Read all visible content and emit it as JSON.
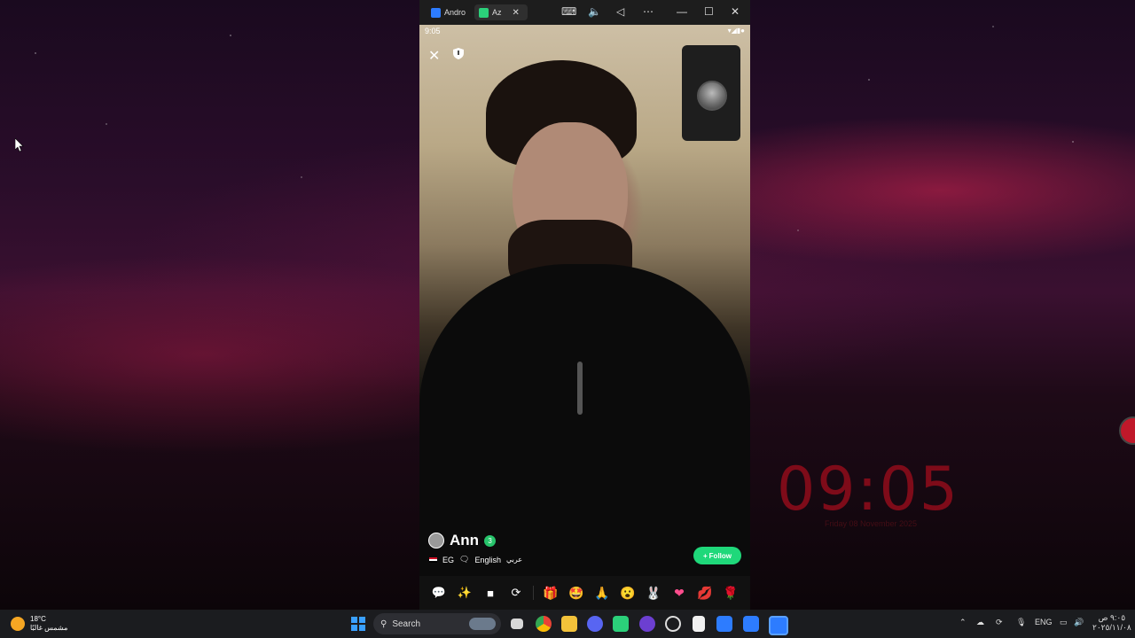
{
  "desktop": {
    "clock_time": "09:05",
    "clock_subtitle": "Friday 08 November 2025"
  },
  "window": {
    "tabs": [
      {
        "label": "Andro",
        "icon": "app-icon"
      },
      {
        "label": "Az",
        "icon": "chat-app-icon"
      }
    ],
    "toolbar_icons": [
      "keyboard-icon",
      "volume-icon",
      "back-icon",
      "more-icon",
      "minimize-icon",
      "maximize-icon",
      "close-icon"
    ]
  },
  "phone": {
    "status_time": "9:05",
    "status_icons": "▾◢▮●",
    "user": {
      "name": "Ann",
      "verified_badge": "3",
      "country": "EG",
      "languages": "English",
      "languages_extra": "عربي"
    },
    "follow_label": "Follow",
    "follow_prefix": "+",
    "controls": [
      "message-icon",
      "magic-wand-icon",
      "camera-icon",
      "switch-camera-icon"
    ],
    "gifts": [
      "gift-box-icon",
      "star-face-icon",
      "praying-hands-icon",
      "surprised-face-icon",
      "bunny-icon",
      "heart-icon",
      "lips-icon",
      "rose-icon"
    ]
  },
  "taskbar": {
    "weather_temp": "18°C",
    "weather_desc": "مشمس غالبًا",
    "search_label": "Search",
    "language": "ENG",
    "clock_time": "٩:٠٥ ص",
    "clock_date": "٢٠٢٥/١١/٠٨",
    "apps": [
      "file-explorer-icon",
      "chrome-icon",
      "folder-icon",
      "discord-icon",
      "android-icon",
      "game-icon",
      "chatgpt-icon",
      "notes-icon",
      "app-icon",
      "app-icon",
      "app-icon"
    ]
  }
}
